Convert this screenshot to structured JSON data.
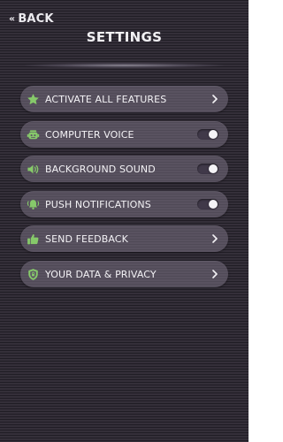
{
  "header": {
    "back_label": "BACK",
    "title": "SETTINGS"
  },
  "colors": {
    "accent_icon": "#86c96a",
    "toggle_track": "#403949",
    "toggle_knob": "#f4f3f6"
  },
  "menu": {
    "items": [
      {
        "label": "ACTIVATE ALL FEATURES",
        "icon": "star-icon",
        "control": "chevron"
      },
      {
        "label": "COMPUTER VOICE",
        "icon": "robot-icon",
        "control": "toggle",
        "toggle_on": true
      },
      {
        "label": "BACKGROUND SOUND",
        "icon": "speaker-icon",
        "control": "toggle",
        "toggle_on": true
      },
      {
        "label": "PUSH NOTIFICATIONS",
        "icon": "bell-icon",
        "control": "toggle",
        "toggle_on": true
      },
      {
        "label": "SEND FEEDBACK",
        "icon": "thumbs-up-icon",
        "control": "chevron"
      },
      {
        "label": "YOUR DATA & PRIVACY",
        "icon": "shield-icon",
        "control": "chevron"
      }
    ]
  }
}
